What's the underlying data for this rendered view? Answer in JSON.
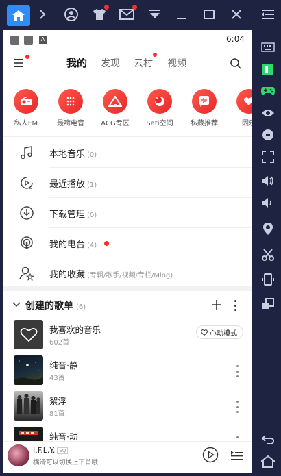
{
  "app": {
    "time": "6:04",
    "status_badge": "A"
  },
  "nav": {
    "tabs": [
      {
        "label": "我的",
        "active": true
      },
      {
        "label": "发现",
        "active": false
      },
      {
        "label": "云村",
        "active": false,
        "badge": true
      },
      {
        "label": "视频",
        "active": false
      }
    ]
  },
  "shortcuts": [
    {
      "label": "私人FM",
      "icon": "radio-icon"
    },
    {
      "label": "最嗨电音",
      "icon": "dots-grid-icon"
    },
    {
      "label": "ACG专区",
      "icon": "acg-icon"
    },
    {
      "label": "Sati空间",
      "icon": "moon-icon"
    },
    {
      "label": "私藏推荐",
      "icon": "waveform-icon"
    },
    {
      "label": "因乐",
      "icon": "heart-icon"
    }
  ],
  "menu": [
    {
      "label": "本地音乐",
      "count": "(0)",
      "icon": "music-note-icon"
    },
    {
      "label": "最近播放",
      "count": "(1)",
      "icon": "recent-play-icon"
    },
    {
      "label": "下载管理",
      "count": "(0)",
      "icon": "download-icon"
    },
    {
      "label": "我的电台",
      "count": "(4)",
      "icon": "podcast-icon",
      "dot": true
    },
    {
      "label": "我的收藏",
      "count": "(专辑/歌手/视频/专栏/Mlog)",
      "icon": "collect-icon"
    }
  ],
  "playlists": {
    "title": "创建的歌单",
    "count": "(6)",
    "items": [
      {
        "name": "我喜欢的音乐",
        "sub": "602首",
        "heart_mode": "心动模式"
      },
      {
        "name": "纯音·静",
        "sub": "43首"
      },
      {
        "name": "絮浮",
        "sub": "81首"
      },
      {
        "name": "纯音·动",
        "sub": ""
      }
    ]
  },
  "player": {
    "song": "I.F.L.Y.",
    "quality": "SQ",
    "tip": "横滑可以切换上下首哦"
  },
  "colors": {
    "accent": "#e8262b",
    "emulator_bg": "#1d2340",
    "home_blue": "#2f8cff"
  }
}
